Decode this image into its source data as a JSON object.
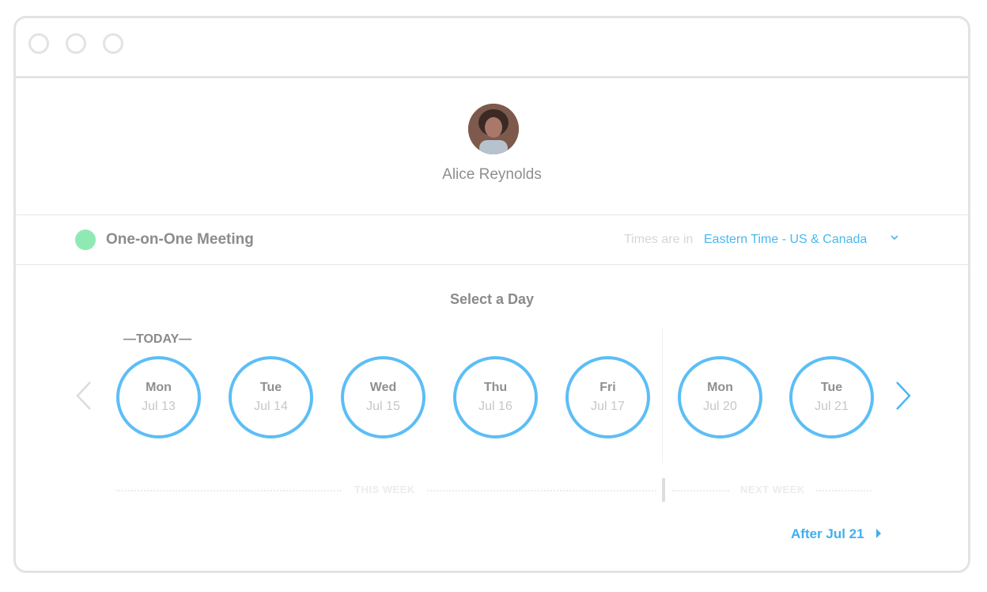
{
  "profile": {
    "name": "Alice Reynolds"
  },
  "event": {
    "name": "One-on-One Meeting",
    "color": "#8fe9b3"
  },
  "timezone": {
    "prefix": "Times are in",
    "value": "Eastern Time - US & Canada"
  },
  "calendar": {
    "title": "Select a Day",
    "today_label": "—TODAY—",
    "days": [
      {
        "name": "Mon",
        "date": "Jul 13"
      },
      {
        "name": "Tue",
        "date": "Jul 14"
      },
      {
        "name": "Wed",
        "date": "Jul 15"
      },
      {
        "name": "Thu",
        "date": "Jul 16"
      },
      {
        "name": "Fri",
        "date": "Jul 17"
      },
      {
        "name": "Mon",
        "date": "Jul 20"
      },
      {
        "name": "Tue",
        "date": "Jul 21"
      }
    ],
    "this_week_label": "THIS WEEK",
    "next_week_label": "NEXT WEEK",
    "after_label": "After Jul 21"
  },
  "colors": {
    "accent": "#4ab8f0",
    "circle": "#5cbef6"
  },
  "icons": {
    "prev": "chevron-left-icon",
    "next": "chevron-right-icon",
    "dropdown": "chevron-down-icon",
    "after": "caret-right-icon"
  }
}
